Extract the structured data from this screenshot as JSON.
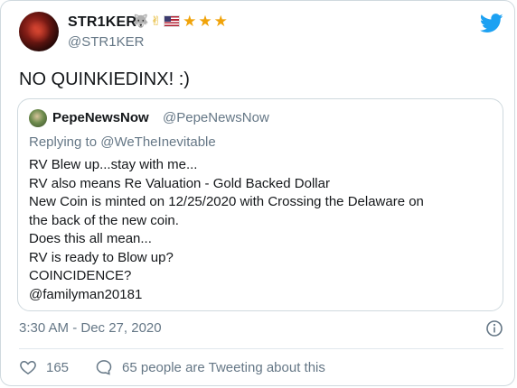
{
  "author": {
    "display_name": "STR1KER",
    "handle": "@STR1KER",
    "name_emojis": [
      "wolf-emoji",
      "hand-emoji",
      "us-flag-emoji",
      "star",
      "star",
      "star"
    ]
  },
  "tweet": {
    "text": "NO QUINKIEDINX! :)",
    "timestamp": "3:30 AM - Dec 27, 2020"
  },
  "quoted_tweet": {
    "display_name": "PepeNewsNow",
    "handle": "@PepeNewsNow",
    "replying_to_prefix": "Replying to ",
    "replying_to_handle": "@WeTheInevitable",
    "lines": [
      "RV Blew up...stay with me...",
      "RV also means Re Valuation - Gold Backed Dollar",
      "New Coin is minted on 12/25/2020 with Crossing the Delaware on",
      "the back of the new coin.",
      "Does this all mean...",
      "RV is ready to Blow up?",
      "COINCIDENCE?",
      "@familyman20181"
    ]
  },
  "actions": {
    "like_count": "165",
    "comment_text": "65 people are Tweeting about this"
  },
  "colors": {
    "text": "#14171a",
    "secondary": "#657786",
    "border": "#cfd9de",
    "twitter_blue": "#1da1f2",
    "star": "#f0a30a"
  },
  "icons": {
    "brand": "twitter-bird-icon",
    "info": "info-icon",
    "like": "heart-icon",
    "comment": "comment-icon"
  }
}
